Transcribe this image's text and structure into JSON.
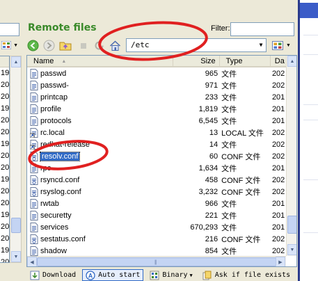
{
  "remote": {
    "title": "Remote files",
    "filter_label": "Filter:",
    "filter_value": "",
    "path": "/etc",
    "columns": {
      "name": "Name",
      "size": "Size",
      "type": "Type",
      "date": "Da"
    },
    "files": [
      {
        "name": "passwd",
        "size": "965",
        "type": "文件",
        "date": "202",
        "icon": "file-icon",
        "selected": false
      },
      {
        "name": "passwd-",
        "size": "971",
        "type": "文件",
        "date": "202",
        "icon": "file-icon",
        "selected": false
      },
      {
        "name": "printcap",
        "size": "233",
        "type": "文件",
        "date": "201",
        "icon": "file-icon",
        "selected": false
      },
      {
        "name": "profile",
        "size": "1,819",
        "type": "文件",
        "date": "201",
        "icon": "file-icon",
        "selected": false
      },
      {
        "name": "protocols",
        "size": "6,545",
        "type": "文件",
        "date": "201",
        "icon": "file-icon",
        "selected": false
      },
      {
        "name": "rc.local",
        "size": "13",
        "type": "LOCAL 文件",
        "date": "202",
        "icon": "shortcut-file-icon",
        "selected": false
      },
      {
        "name": "redhat-release",
        "size": "14",
        "type": "文件",
        "date": "202",
        "icon": "shortcut-file-icon",
        "selected": false
      },
      {
        "name": "resolv.conf",
        "size": "60",
        "type": "CONF 文件",
        "date": "202",
        "icon": "config-file-icon",
        "selected": true
      },
      {
        "name": "rpc",
        "size": "1,634",
        "type": "文件",
        "date": "201",
        "icon": "file-icon",
        "selected": false
      },
      {
        "name": "rsyncd.conf",
        "size": "458",
        "type": "CONF 文件",
        "date": "202",
        "icon": "config-file-icon",
        "selected": false
      },
      {
        "name": "rsyslog.conf",
        "size": "3,232",
        "type": "CONF 文件",
        "date": "202",
        "icon": "config-file-icon",
        "selected": false
      },
      {
        "name": "rwtab",
        "size": "966",
        "type": "文件",
        "date": "201",
        "icon": "file-icon",
        "selected": false
      },
      {
        "name": "securetty",
        "size": "221",
        "type": "文件",
        "date": "201",
        "icon": "file-icon",
        "selected": false
      },
      {
        "name": "services",
        "size": "670,293",
        "type": "文件",
        "date": "201",
        "icon": "file-icon",
        "selected": false
      },
      {
        "name": "sestatus.conf",
        "size": "216",
        "type": "CONF 文件",
        "date": "202",
        "icon": "config-file-icon",
        "selected": false
      },
      {
        "name": "shadow",
        "size": "854",
        "type": "文件",
        "date": "202",
        "icon": "file-icon",
        "selected": false
      }
    ]
  },
  "left": {
    "rows": [
      "19-",
      "20-",
      "20-",
      "19-",
      "20-",
      "20-",
      "19-",
      "20-",
      "20-",
      "19-",
      "20-",
      "20-",
      "19-",
      "20-",
      "20-",
      "19-",
      "20-"
    ]
  },
  "statusbar": {
    "download": "Download",
    "auto_start": "Auto start",
    "binary": "Binary",
    "ask_if_exists": "Ask if file exists"
  },
  "colors": {
    "title_green": "#3a8a2a",
    "selection_blue": "#316ac5",
    "annotation_red": "#e02020"
  }
}
